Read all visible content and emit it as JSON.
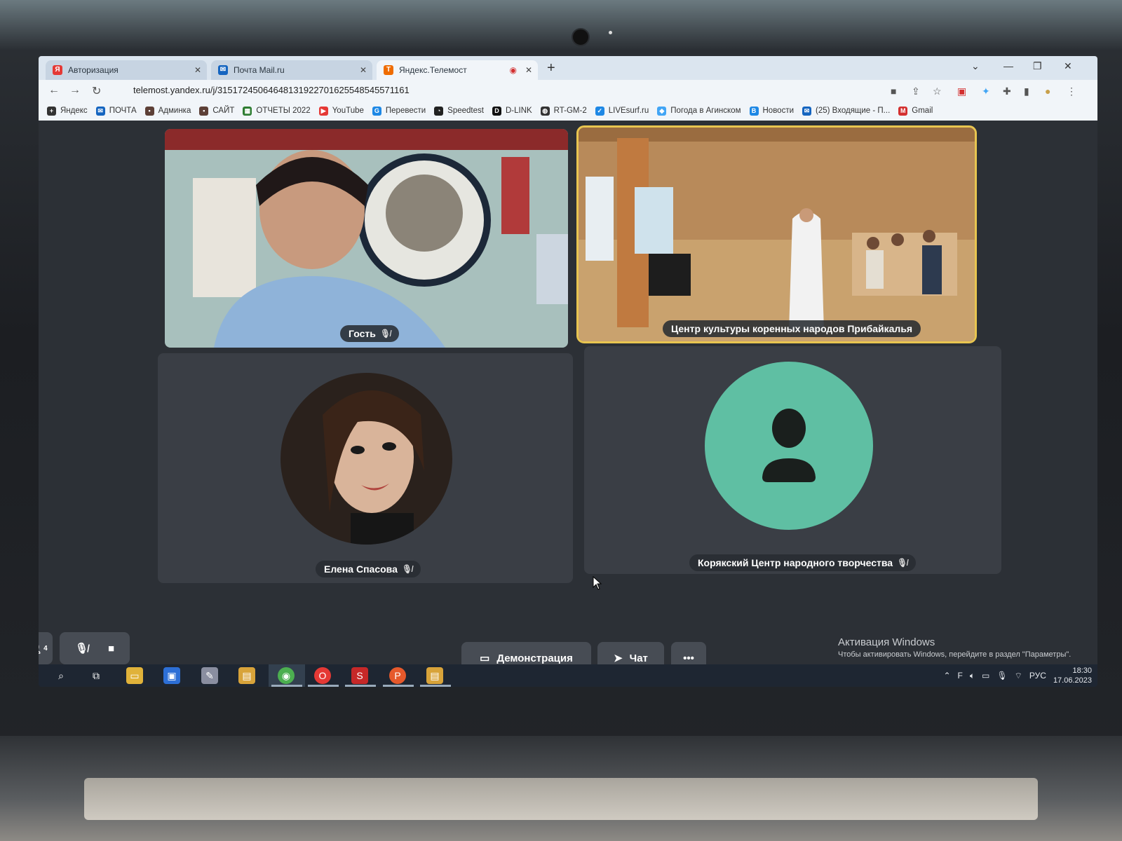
{
  "browser": {
    "tabs": [
      {
        "label": "Авторизация",
        "favicon": "yandex-icon",
        "color": "#e53935"
      },
      {
        "label": "Почта Mail.ru",
        "favicon": "mail-icon",
        "color": "#1565c0"
      },
      {
        "label": "Яндекс.Телемост",
        "favicon": "telemost-icon",
        "color": "#ef6c00"
      }
    ],
    "new_tab": "+",
    "url": "telemost.yandex.ru/j/31517245064648131922701625548545571161",
    "bookmarks": [
      {
        "label": "Яндекс",
        "icon": "yandex-icon",
        "color": "#333"
      },
      {
        "label": "ПОЧТА",
        "icon": "mail-icon",
        "color": "#1565c0"
      },
      {
        "label": "Админка",
        "icon": "admin-icon",
        "color": "#5d4037"
      },
      {
        "label": "САЙТ",
        "icon": "site-icon",
        "color": "#5d4037"
      },
      {
        "label": "ОТЧЕТЫ 2022",
        "icon": "sheets-icon",
        "color": "#2e7d32"
      },
      {
        "label": "YouTube",
        "icon": "youtube-icon",
        "color": "#e53935"
      },
      {
        "label": "Перевести",
        "icon": "translate-icon",
        "color": "#1e88e5"
      },
      {
        "label": "Speedtest",
        "icon": "speedtest-icon",
        "color": "#222"
      },
      {
        "label": "D-LINK",
        "icon": "dlink-icon",
        "color": "#111"
      },
      {
        "label": "RT-GM-2",
        "icon": "globe-icon",
        "color": "#333"
      },
      {
        "label": "LIVEsurf.ru",
        "icon": "livesurf-icon",
        "color": "#1e88e5"
      },
      {
        "label": "Погода в Агинском",
        "icon": "weather-icon",
        "color": "#42a5f5"
      },
      {
        "label": "Новости",
        "icon": "vk-icon",
        "color": "#1e88e5"
      },
      {
        "label": "(25) Входящие - П...",
        "icon": "mail-icon",
        "color": "#1565c0"
      },
      {
        "label": "Gmail",
        "icon": "gmail-icon",
        "color": "#d32f2f"
      }
    ]
  },
  "participants": [
    {
      "name": "Гость",
      "muted": true,
      "type": "video"
    },
    {
      "name": "Центр культуры коренных народов Прибайкалья",
      "muted": false,
      "type": "video",
      "speaking": true
    },
    {
      "name": "Елена Спасова",
      "muted": true,
      "type": "avatar-photo"
    },
    {
      "name": "Корякский Центр народного творчества",
      "muted": true,
      "type": "avatar-placeholder",
      "avatar_color": "#5fbfa3"
    }
  ],
  "controls": {
    "participants_badge": "4",
    "demo_label": "Демонстрация",
    "chat_label": "Чат",
    "more_label": "•••"
  },
  "watermark": {
    "line1": "Активация Windows",
    "line2": "Чтобы активировать Windows, перейдите в раздел \"Параметры\"."
  },
  "taskbar": {
    "language": "РУС",
    "time": "18:30",
    "date": "17.06.2023"
  }
}
